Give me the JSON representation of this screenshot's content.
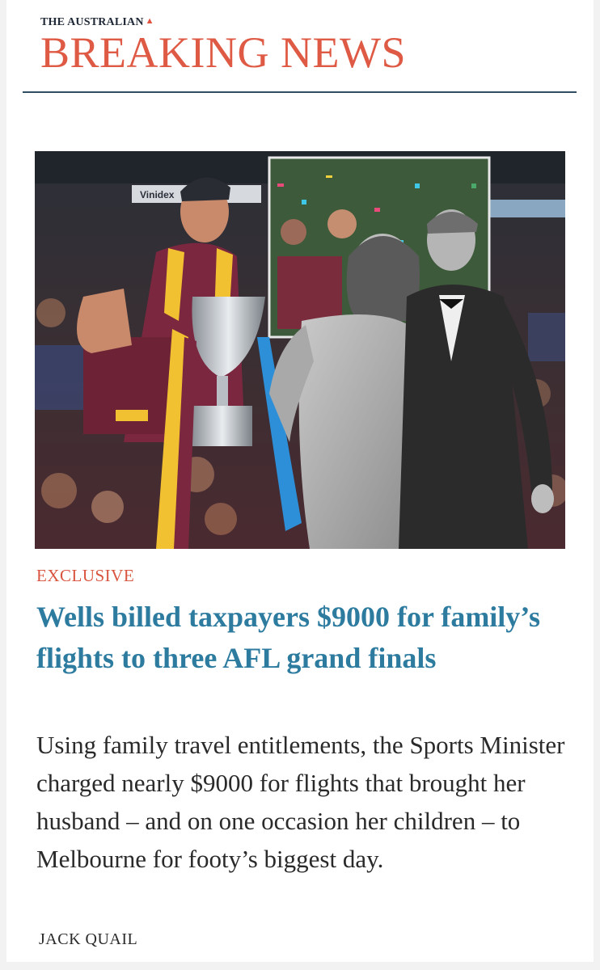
{
  "masthead": {
    "brand": "THE AUSTRALIAN",
    "section": "BREAKING NEWS"
  },
  "colors": {
    "accent": "#df5a44",
    "headline": "#2d7ca0",
    "rule": "#2f4e62"
  },
  "hero": {
    "banner_text": "Vinidex"
  },
  "article": {
    "kicker": "EXCLUSIVE",
    "headline": "Wells billed taxpayers $9000 for family’s flights to three AFL grand finals",
    "standfirst": "Using family travel entitlements, the Sports Minister charged nearly $9000 for flights that brought her husband – and on one occasion her children – to Melbourne for footy’s biggest day.",
    "byline": "JACK QUAIL"
  }
}
